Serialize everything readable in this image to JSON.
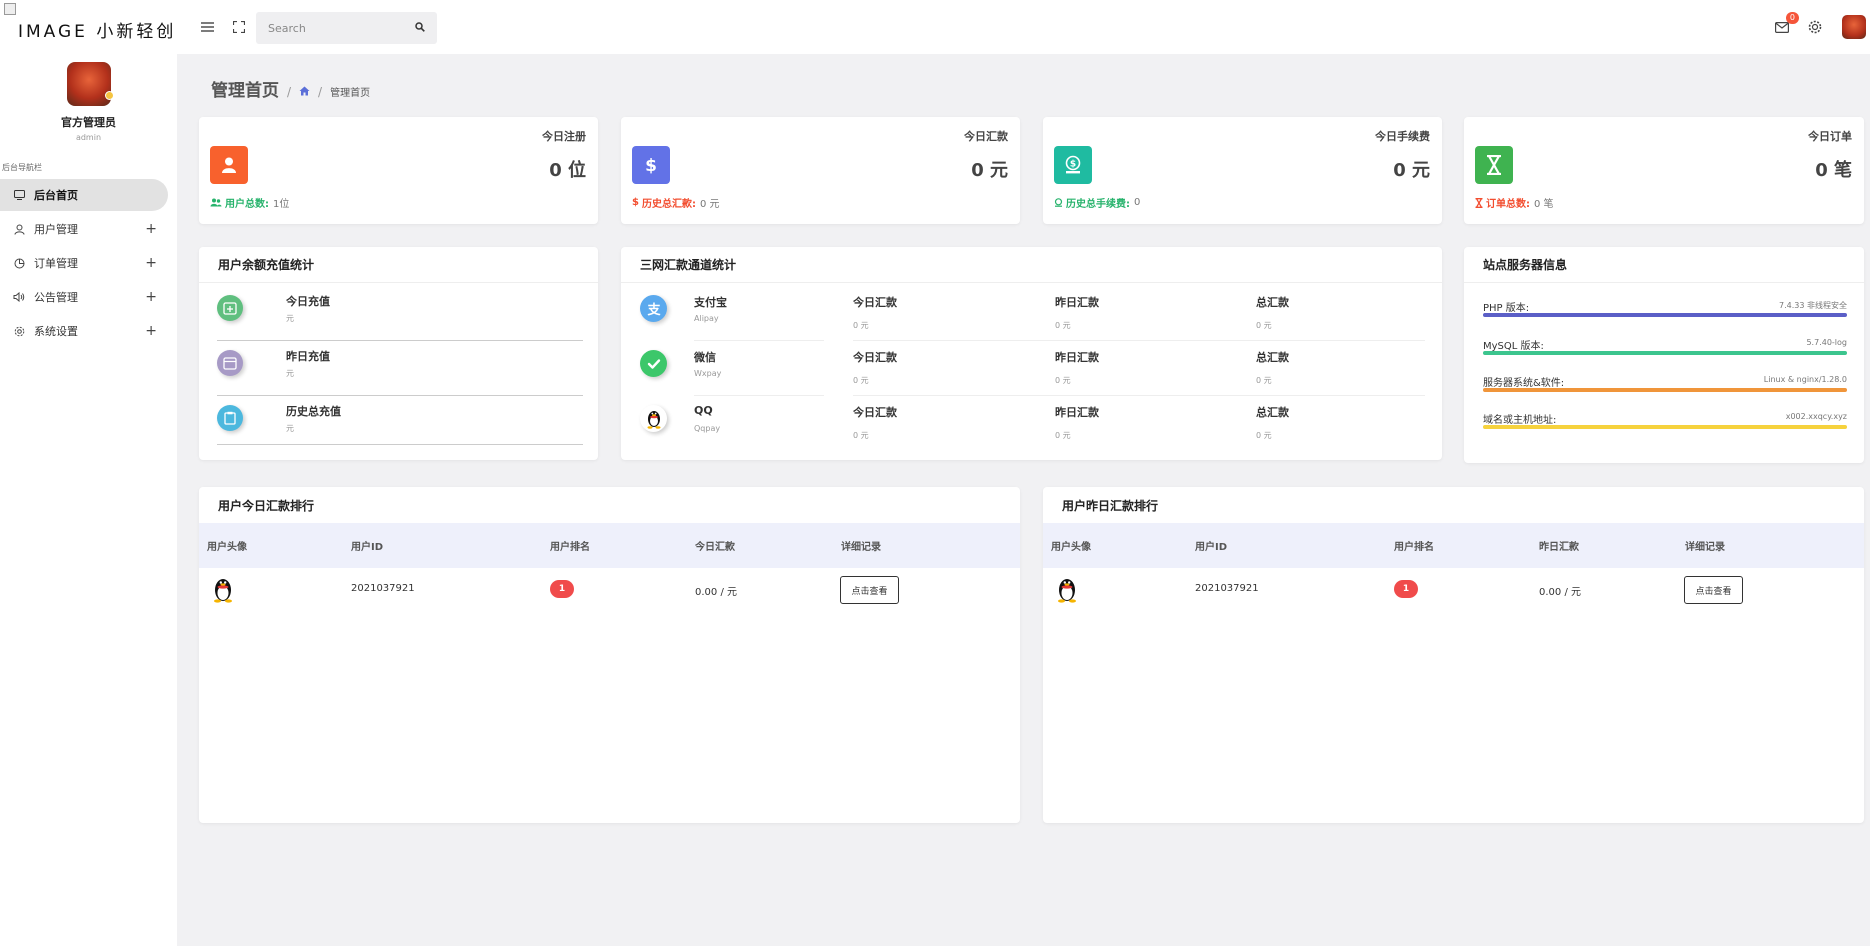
{
  "brand": {
    "text": "IMAGE 小新轻创"
  },
  "user": {
    "name": "官方管理员",
    "role": "admin"
  },
  "nav": {
    "caption": "后台导航栏",
    "items": [
      {
        "label": "后台首页",
        "icon": "monitor-icon",
        "active": true
      },
      {
        "label": "用户管理",
        "icon": "user-icon"
      },
      {
        "label": "订单管理",
        "icon": "pie-chart-icon"
      },
      {
        "label": "公告管理",
        "icon": "speaker-icon"
      },
      {
        "label": "系统设置",
        "icon": "gear-icon"
      }
    ],
    "expand_symbol": "+"
  },
  "header": {
    "search_placeholder": "Search",
    "mail_count": "0"
  },
  "breadcrumb": {
    "title": "管理首页",
    "sep": "/",
    "current": "管理首页"
  },
  "stats": [
    {
      "label": "今日注册",
      "value": "0 位",
      "foot_label": "用户总数:",
      "foot_value": "1位",
      "color": "#f8612d",
      "foot_color": "#27b36c"
    },
    {
      "label": "今日汇款",
      "value": "0 元",
      "foot_label": "历史总汇款:",
      "foot_value": "0 元",
      "color": "#6272e7",
      "foot_color": "#f24d2f"
    },
    {
      "label": "今日手续费",
      "value": "0 元",
      "foot_label": "历史总手续费:",
      "foot_value": "0",
      "color": "#1fbba1",
      "foot_color": "#27b36c"
    },
    {
      "label": "今日订单",
      "value": "0 笔",
      "foot_label": "订单总数:",
      "foot_value": "0 笔",
      "color": "#3fb350",
      "foot_color": "#f24d2f"
    }
  ],
  "recharge": {
    "title": "用户余额充值统计",
    "rows": [
      {
        "title": "今日充值",
        "sub": "元"
      },
      {
        "title": "昨日充值",
        "sub": "元"
      },
      {
        "title": "历史总充值",
        "sub": "元"
      }
    ]
  },
  "channels": {
    "title": "三网汇款通道统计",
    "rows": [
      {
        "name": "支付宝",
        "sub": "Alipay",
        "today_label": "今日汇款",
        "today": "0 元",
        "yesterday_label": "昨日汇款",
        "yesterday": "0 元",
        "total_label": "总汇款",
        "total": "0 元"
      },
      {
        "name": "微信",
        "sub": "Wxpay",
        "today_label": "今日汇款",
        "today": "0 元",
        "yesterday_label": "昨日汇款",
        "yesterday": "0 元",
        "total_label": "总汇款",
        "total": "0 元"
      },
      {
        "name": "QQ",
        "sub": "Qqpay",
        "today_label": "今日汇款",
        "today": "0 元",
        "yesterday_label": "昨日汇款",
        "yesterday": "0 元",
        "total_label": "总汇款",
        "total": "0 元"
      }
    ]
  },
  "server": {
    "title": "站点服务器信息",
    "items": [
      {
        "key": "PHP 版本:",
        "value": "7.4.33 非线程安全",
        "color": "#5b5fc7"
      },
      {
        "key": "MySQL 版本:",
        "value": "5.7.40-log",
        "color": "#3cc58e"
      },
      {
        "key": "服务器系统&软件:",
        "value": "Linux & nginx/1.28.0",
        "color": "#f0953a"
      },
      {
        "key": "域名或主机地址:",
        "value": "x002.xxqcy.xyz",
        "color": "#f6d23d"
      }
    ]
  },
  "rank_today": {
    "title": "用户今日汇款排行",
    "headers": [
      "用户头像",
      "用户ID",
      "用户排名",
      "今日汇款",
      "详细记录"
    ],
    "rows": [
      {
        "id": "2021037921",
        "rank": "1",
        "amount": "0.00 / 元",
        "button": "点击查看"
      }
    ]
  },
  "rank_yesterday": {
    "title": "用户昨日汇款排行",
    "headers": [
      "用户头像",
      "用户ID",
      "用户排名",
      "昨日汇款",
      "详细记录"
    ],
    "rows": [
      {
        "id": "2021037921",
        "rank": "1",
        "amount": "0.00 / 元",
        "button": "点击查看"
      }
    ]
  }
}
